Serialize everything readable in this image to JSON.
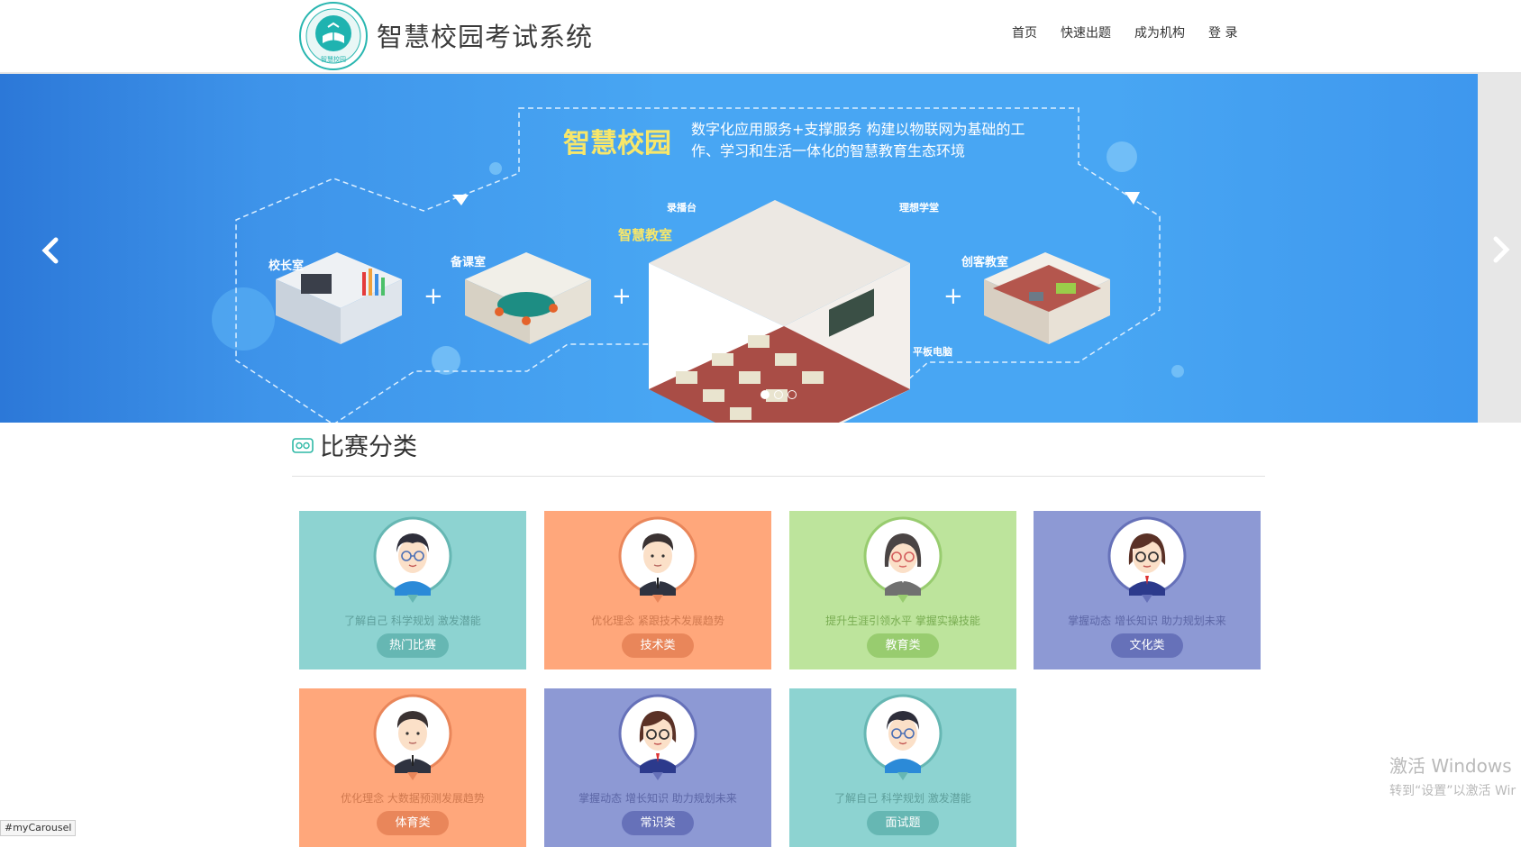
{
  "header": {
    "brand": "智慧校园考试系统",
    "logo_text": "智慧校园",
    "nav": [
      "首页",
      "快速出题",
      "成为机构",
      "登 录"
    ]
  },
  "banner": {
    "title": "智慧校园",
    "text": "数字化应用服务+支撑服务  构建以物联网为基础的工作、学习和生活一体化的智慧教育生态环境",
    "rooms": [
      "校长室",
      "备课室",
      "智慧教室",
      "创客教室"
    ],
    "labels": [
      "录播台",
      "理想学堂",
      "平板电脑"
    ],
    "prev_icon": "chevron-left-icon",
    "next_icon": "chevron-right-icon",
    "active_slide": 1,
    "slide_count": 3
  },
  "section": {
    "title": "比赛分类",
    "icon": "glasses-icon"
  },
  "categories": [
    {
      "desc": "了解自己 科学规划 激发潜能",
      "label": "热门比赛",
      "bg": "#8dd3d1",
      "pill": "#66b7b3",
      "text": "#5e9f9b",
      "avatar": "boy-glasses"
    },
    {
      "desc": "优化理念 紧跟技术发展趋势",
      "label": "技术类",
      "bg": "#ffa77b",
      "pill": "#e9865a",
      "text": "#d0794f",
      "avatar": "man-suit"
    },
    {
      "desc": "提升生涯引领水平 掌握实操技能",
      "label": "教育类",
      "bg": "#bde49c",
      "pill": "#98cc6f",
      "text": "#79ad52",
      "avatar": "woman-glasses"
    },
    {
      "desc": "掌握动态 增长知识 助力规划未来",
      "label": "文化类",
      "bg": "#8d99d4",
      "pill": "#6671b9",
      "text": "#5c66a6",
      "avatar": "girl-glasses"
    },
    {
      "desc": "优化理念 大数据预测发展趋势",
      "label": "体育类",
      "bg": "#ffa77b",
      "pill": "#e9865a",
      "text": "#d0794f",
      "avatar": "man-suit"
    },
    {
      "desc": "掌握动态 增长知识 助力规划未来",
      "label": "常识类",
      "bg": "#8d99d4",
      "pill": "#6671b9",
      "text": "#5c66a6",
      "avatar": "girl-glasses"
    },
    {
      "desc": "了解自己 科学规划 激发潜能",
      "label": "面试题",
      "bg": "#8dd3d1",
      "pill": "#66b7b3",
      "text": "#5e9f9b",
      "avatar": "boy-glasses"
    }
  ],
  "watermark": {
    "line1": "激活 Windows",
    "line2": "转到“设置”以激活 Wir"
  },
  "status_link": "#myCarousel"
}
